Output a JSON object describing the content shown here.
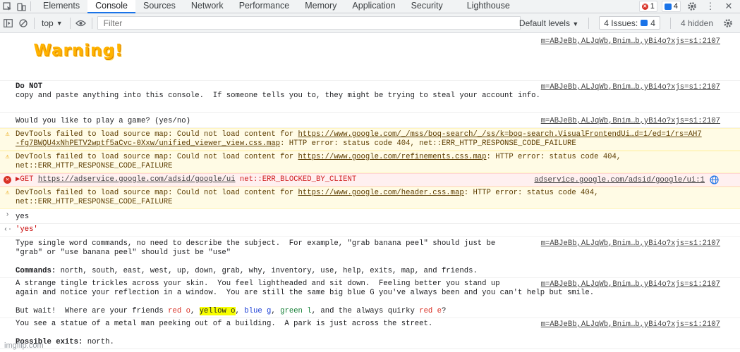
{
  "tabs": [
    "Elements",
    "Console",
    "Sources",
    "Network",
    "Performance",
    "Memory",
    "Application",
    "Security",
    "Lighthouse"
  ],
  "active_tab": "Console",
  "top_counts": {
    "errors": "1",
    "issues": "4"
  },
  "toolbar": {
    "context": "top",
    "filter_placeholder": "Filter",
    "levels": "Default levels",
    "issues": "4 Issues:",
    "issues_count": "4",
    "hidden": "4 hidden"
  },
  "source_ref": "m=ABJeBb,ALJqWb,Bnim…b,yBi4o?xjs=s1:2107",
  "messages": {
    "warning_title": "Warning!",
    "do_not_bold": "Do NOT",
    "do_not_text": "copy and paste anything into this console.  If someone tells you to, they might be trying to steal your account info.",
    "play_game": "Would you like to play a game? (yes/no)",
    "w1_pre": "DevTools failed to load source map: Could not load content for ",
    "w1_link": "https://www.google.com/_/mss/boq-search/_/ss/k=boq-search.VisualFrontendUi…d=1/ed=1/rs=AH7\n-fg7BWQU4xNhPETV2wptf5aCvc-0Xxw/unified_viewer_view.css.map",
    "w1_post": ": HTTP error: status code 404, net::ERR_HTTP_RESPONSE_CODE_FAILURE",
    "w2_pre": "DevTools failed to load source map: Could not load content for ",
    "w2_link": "https://www.google.com/refinements.css.map",
    "w2_post": ": HTTP error: status code 404,\nnet::ERR_HTTP_RESPONSE_CODE_FAILURE",
    "err_method": "▶GET ",
    "err_link": "https://adservice.google.com/adsid/google/ui",
    "err_post": " net::ERR_BLOCKED_BY_CLIENT",
    "err_src": "adservice.google.com/adsid/google/ui:1",
    "w3_pre": "DevTools failed to load source map: Could not load content for ",
    "w3_link": "https://www.google.com/header.css.map",
    "w3_post": ": HTTP error: status code 404,\nnet::ERR_HTTP_RESPONSE_CODE_FAILURE",
    "input": "yes",
    "result": "'yes'",
    "help_text": "Type single word commands, no need to describe the subject.  For example, \"grab banana peel\" should just be\n\"grab\" or \"use banana peel\" should just be \"use\"",
    "commands_label": "Commands:",
    "commands_list": " north, south, east, west, up, down, grab, why, inventory, use, help, exits, map, and friends.",
    "story1": "A strange tingle trickles across your skin.  You feel lightheaded and sit down.  Feeling better you stand up\nagain and notice your reflection in a window.  You are still the same big blue G you've always been and you can't help but smile.",
    "but_wait": "But wait!  Where are your friends ",
    "f_red": "red o",
    "f_sep1": ", ",
    "f_yellow": "yellow o",
    "f_sep2": ", ",
    "f_blue": "blue g",
    "f_sep3": ", ",
    "f_green": "green l",
    "f_and": ", and the always quirky ",
    "f_red2": "red e",
    "f_q": "?",
    "statue": "You see a statue of a metal man peeking out of a building.  A park is just across the street.",
    "exits_label": "Possible exits:",
    "exits_list": " north."
  },
  "watermark": "imgflip.com"
}
